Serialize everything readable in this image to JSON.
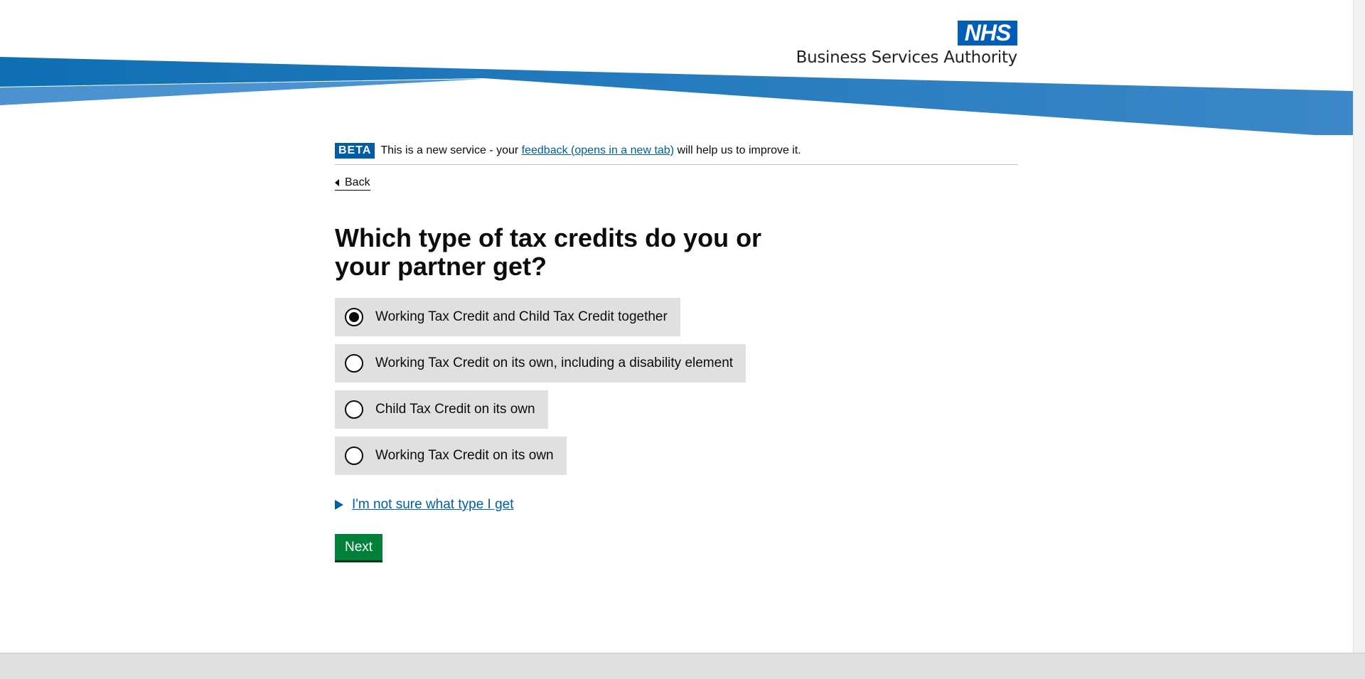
{
  "header": {
    "logo_text": "NHS",
    "org_name": "Business Services Authority",
    "colors": {
      "banner_dark": "#0f6fb3",
      "banner_light": "#4a92d0",
      "logo": "#005eb8"
    }
  },
  "phase_banner": {
    "tag": "BETA",
    "text_before": "This is a new service - your ",
    "link_text": "feedback (opens in a new tab)",
    "text_after": " will help us to improve it."
  },
  "back_link": "Back",
  "question": "Which type of tax credits do you or your partner get?",
  "options": [
    {
      "label": "Working Tax Credit and Child Tax Credit together",
      "selected": true
    },
    {
      "label": "Working Tax Credit on its own, including a disability element",
      "selected": false
    },
    {
      "label": "Child Tax Credit on its own",
      "selected": false
    },
    {
      "label": "Working Tax Credit on its own",
      "selected": false
    }
  ],
  "details_summary": "I'm not sure what type I get",
  "next_button": "Next",
  "icons": {
    "back": "caret-left-icon",
    "details": "triangle-right-icon",
    "radio": "radio-icon"
  },
  "accent_colors": {
    "link": "#005ea5",
    "button": "#00823b",
    "option_bg": "#dee0e2"
  }
}
